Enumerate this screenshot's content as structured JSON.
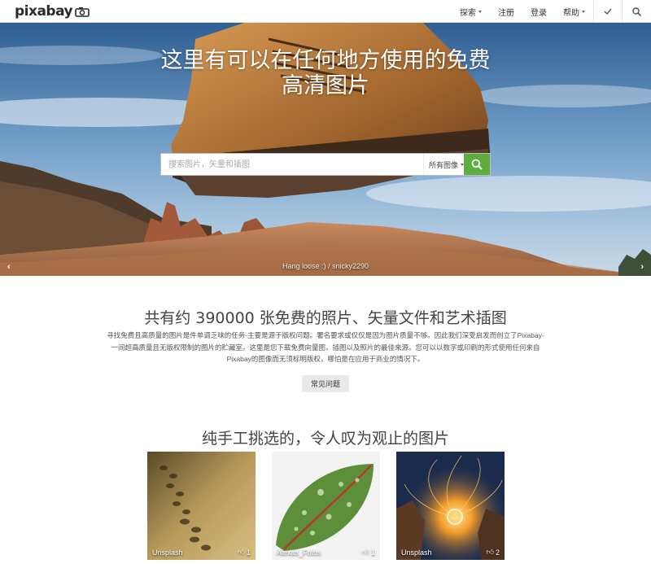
{
  "brand": {
    "name": "pixabay"
  },
  "nav": {
    "explore": "探索",
    "register": "注册",
    "login": "登录",
    "help": "帮助"
  },
  "hero": {
    "title_line1": "这里有可以在任何地方使用的免费",
    "title_line2": "高清图片",
    "search_placeholder": "搜索图片，矢量和插图",
    "search_type": "所有图像",
    "caption": "Hang loose :) / snicky2290"
  },
  "about": {
    "heading": "共有约 390000 张免费的照片、矢量文件和艺术插图",
    "text": "寻找免费且高质量的图片是件单调乏味的任务-主要是源于版权问题。署名要求或仅仅是因为图片质量不够。因此我们深受启发而创立了Pixabay-一间超高质量且无版权限制的图片的贮藏室。这里是您下载免费向量图，插图以及照片的最佳来源。您可以以数字或印刷的形式使用任何来自Pixabay的图像而无须标明版权，哪怕是在应用于商业的情况下。",
    "faq_button": "常见问题"
  },
  "gallery": {
    "heading": "纯手工挑选的，令人叹为观止的图片",
    "items": [
      {
        "user": "Unsplash",
        "likes": "1"
      },
      {
        "user": "Alexas_Fotos",
        "likes": "1"
      },
      {
        "user": "Unsplash",
        "likes": "2"
      }
    ]
  },
  "colors": {
    "accent_green": "#5dae3e"
  },
  "icons": [
    "camera-icon",
    "check-icon",
    "search-icon",
    "chevron-left-icon",
    "chevron-right-icon",
    "thumbs-up-icon"
  ]
}
